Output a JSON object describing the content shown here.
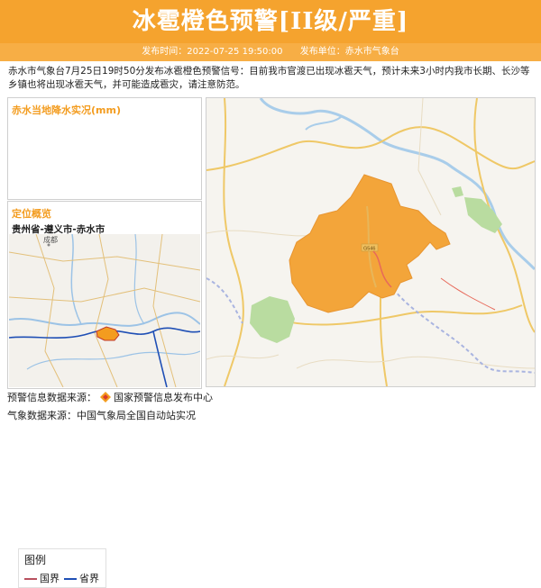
{
  "header": {
    "title": "冰雹橙色预警[II级/严重]",
    "publish_time_label": "发布时间：2022-07-25 19:50:00",
    "publisher_label": "发布单位：赤水市气象台"
  },
  "description": "赤水市气象台7月25日19时50分发布冰雹橙色预警信号：目前我市官渡已出现冰雹天气，预计未来3小时内我市长期、长沙等乡镇也将出现冰雹天气，并可能造成雹灾，请注意防范。",
  "rain_panel": {
    "title": "赤水当地降水实况(mm)"
  },
  "location_panel": {
    "title": "定位概览",
    "subtitle": "贵州省-遵义市-赤水市",
    "map_label": "成都"
  },
  "legend": {
    "title": "图例",
    "items": [
      {
        "label": "国界",
        "color": "#b8505f"
      },
      {
        "label": "省界",
        "color": "#1f4fb5"
      }
    ]
  },
  "map": {
    "road_label": "G546"
  },
  "footer": {
    "source1": "预警信息数据来源：",
    "source1_name": "国家预警信息发布中心",
    "source2": "气象数据来源：中国气象局全国自动站实况"
  },
  "colors": {
    "warning": "#f39c1f",
    "header": "#f5a32e"
  }
}
